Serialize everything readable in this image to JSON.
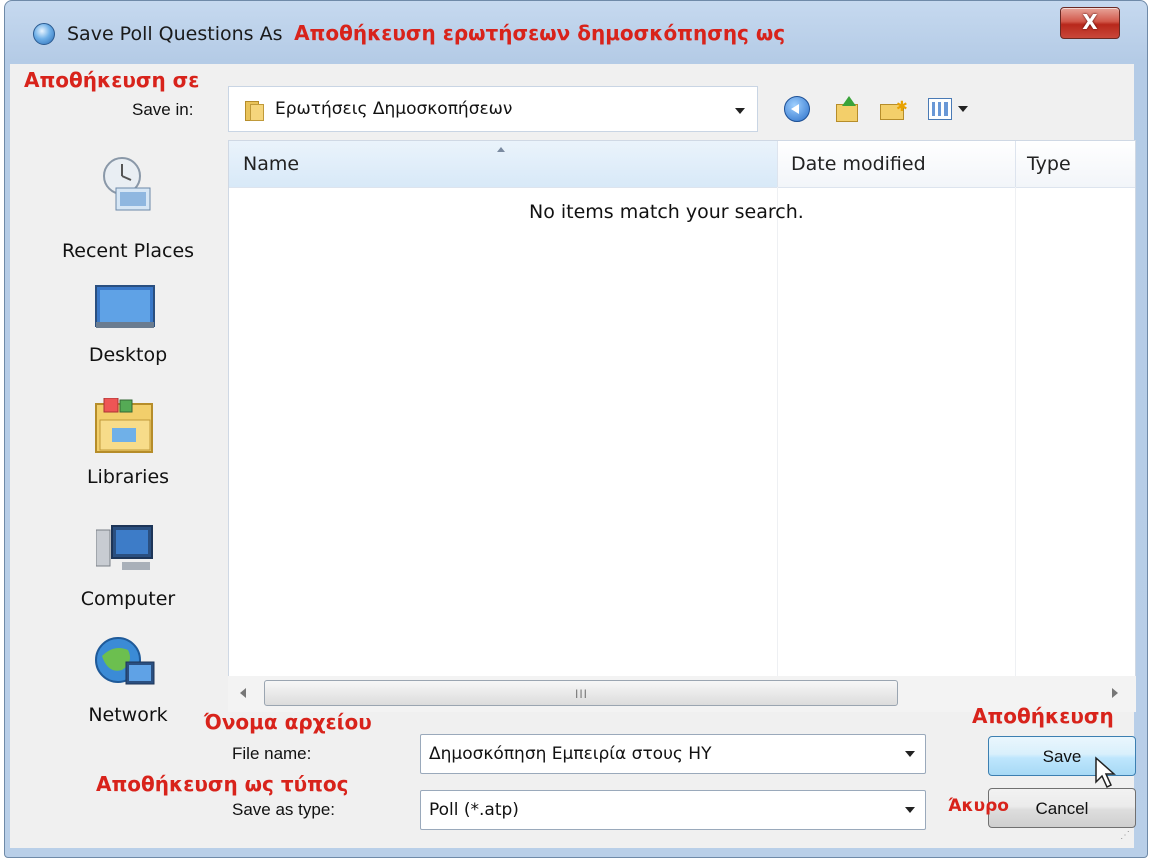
{
  "window": {
    "title": "Save Poll Questions As",
    "title_translation": "Αποθήκευση ερωτήσεων δημοσκόπησης ως",
    "close_symbol": "X"
  },
  "toolbar": {
    "save_in_translation": "Αποθήκευση σε",
    "save_in_label": "Save in:",
    "save_in_value": "Ερωτήσεις Δημοσκοπήσεων",
    "icons": [
      "back-icon",
      "up-folder-icon",
      "new-folder-icon",
      "views-menu-icon"
    ]
  },
  "places": [
    {
      "label": "Recent Places",
      "icon": "recent-places-icon"
    },
    {
      "label": "Desktop",
      "icon": "desktop-icon"
    },
    {
      "label": "Libraries",
      "icon": "libraries-icon"
    },
    {
      "label": "Computer",
      "icon": "computer-icon"
    },
    {
      "label": "Network",
      "icon": "network-icon"
    }
  ],
  "file_list": {
    "columns": [
      "Name",
      "Date modified",
      "Type"
    ],
    "empty_message": "No items match your search.",
    "scroll_grip": "III"
  },
  "form": {
    "filename_translation": "Όνομα αρχείου",
    "filename_label": "File name:",
    "filename_value": "Δημοσκόπηση Εμπειρία στους HY",
    "type_translation": "Αποθήκευση ως τύπος",
    "type_label": "Save as type:",
    "type_value": "Poll (*.atp)"
  },
  "buttons": {
    "save_translation": "Αποθήκευση",
    "save_label": "Save",
    "cancel_translation": "Άκυρο",
    "cancel_label": "Cancel"
  }
}
